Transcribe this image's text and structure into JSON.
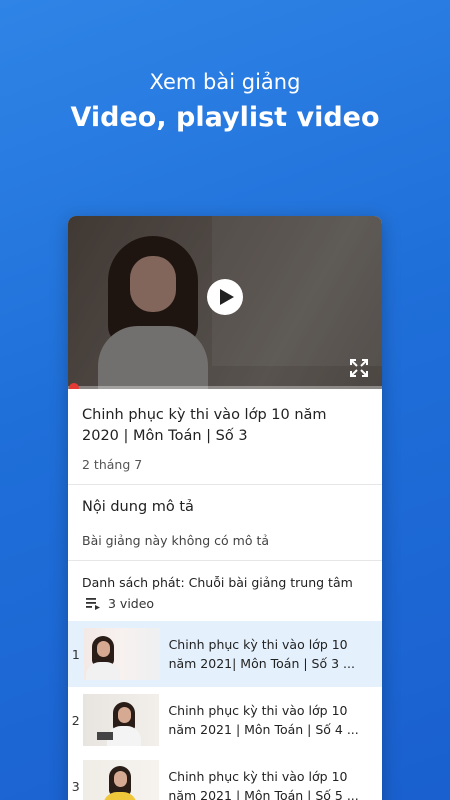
{
  "promo": {
    "subtitle": "Xem bài giảng",
    "title": "Video, playlist video"
  },
  "player": {
    "progress": 0.0
  },
  "video": {
    "title": "Chinh phục kỳ thi vào lớp 10 năm 2020 | Môn Toán | Số 3",
    "date": "2 tháng 7"
  },
  "description": {
    "heading": "Nội dung mô tả",
    "text": "Bài giảng này không có mô tả"
  },
  "playlist": {
    "name": "Danh sách phát: Chuỗi bài giảng trung tâm",
    "count": "3 video",
    "items": [
      {
        "index": "1",
        "title": "Chinh phục kỳ thi vào lớp 10 năm 2021| Môn Toán | Số 3 ..."
      },
      {
        "index": "2",
        "title": "Chinh phục kỳ thi vào lớp 10 năm 2021 | Môn Toán | Số 4 ..."
      },
      {
        "index": "3",
        "title": "Chinh phục kỳ thi vào lớp 10 năm 2021 | Môn Toán | Số 5 ..."
      }
    ]
  },
  "icons": {
    "play": "play-icon",
    "fullscreen": "fullscreen-icon",
    "playlist": "playlist-icon"
  },
  "colors": {
    "background": "#1f6fd9",
    "progress_dot": "#e53935",
    "active_row": "#e4f0fc"
  }
}
